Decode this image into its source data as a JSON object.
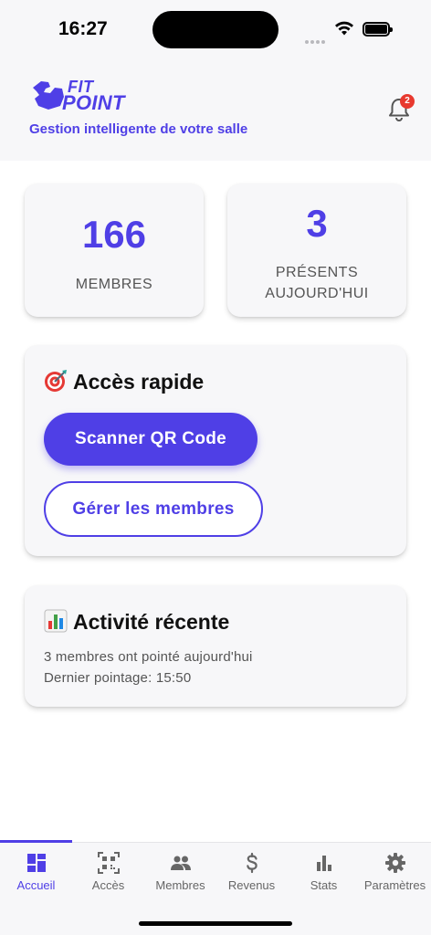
{
  "status_bar": {
    "time": "16:27"
  },
  "header": {
    "logo_line1": "FIT",
    "logo_line2": "POINT",
    "tagline": "Gestion intelligente de votre salle",
    "notification_count": "2"
  },
  "stats": [
    {
      "value": "166",
      "label": "MEMBRES"
    },
    {
      "value": "3",
      "label_line1": "PRÉSENTS",
      "label_line2": "AUJOURD'HUI"
    }
  ],
  "quick_access": {
    "title": "Accès rapide",
    "emoji": "target-emoji-icon",
    "scan_label": "Scanner QR Code",
    "manage_label": "Gérer les membres"
  },
  "recent_activity": {
    "title": "Activité récente",
    "emoji": "bar-chart-emoji-icon",
    "line1": "3 membres ont pointé aujourd'hui",
    "line2": "Dernier pointage: 15:50"
  },
  "nav": {
    "items": [
      {
        "label": "Accueil",
        "icon": "dashboard-icon",
        "active": true
      },
      {
        "label": "Accès",
        "icon": "qr-code-icon",
        "active": false
      },
      {
        "label": "Membres",
        "icon": "people-icon",
        "active": false
      },
      {
        "label": "Revenus",
        "icon": "dollar-icon",
        "active": false
      },
      {
        "label": "Stats",
        "icon": "bar-chart-icon",
        "active": false
      },
      {
        "label": "Paramètres",
        "icon": "gear-icon",
        "active": false
      }
    ]
  },
  "colors": {
    "accent": "#4f3fe6",
    "badge": "#e8392f",
    "surface": "#f7f7f9"
  }
}
